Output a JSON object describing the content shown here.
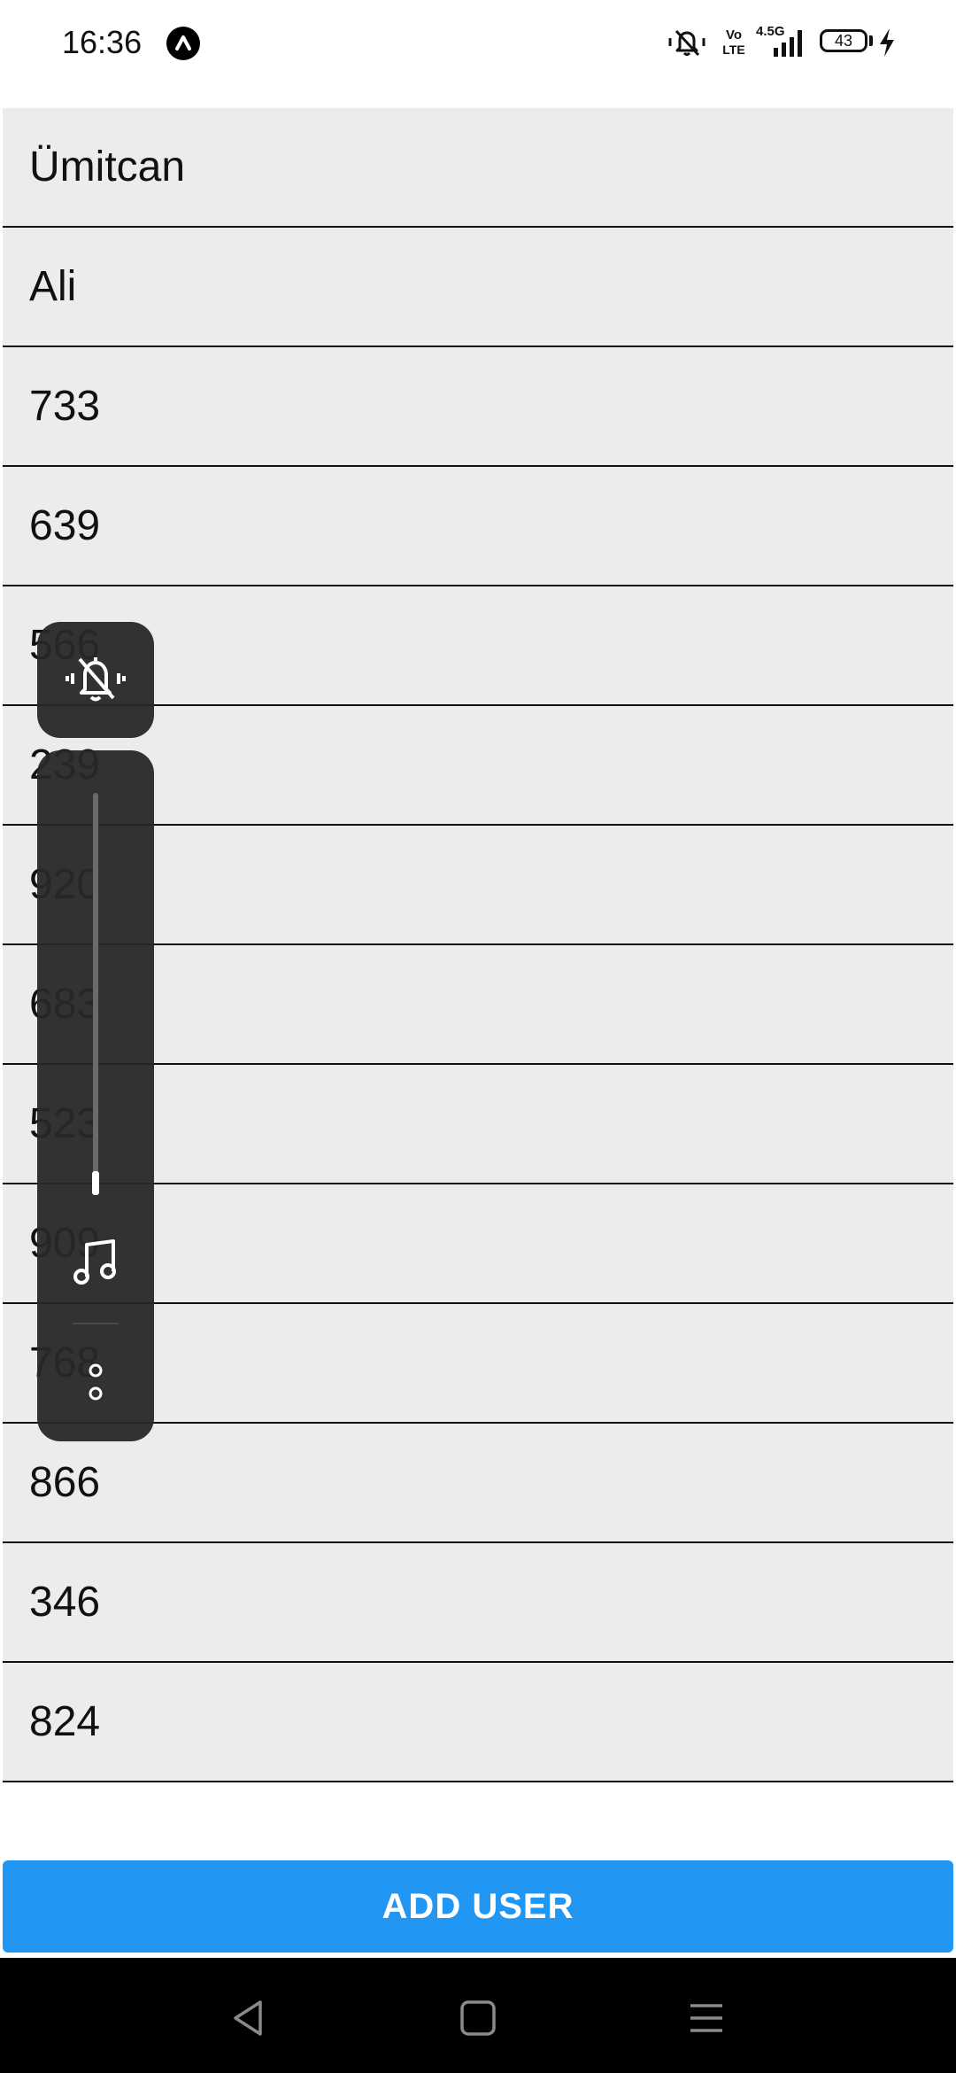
{
  "status_bar": {
    "time": "16:36",
    "network_label": "4.5G",
    "volte_label": "Vo LTE",
    "battery_level": "43",
    "icons": [
      "app-notification-icon",
      "vibrate-mute-icon",
      "volte-icon",
      "signal-icon",
      "battery-icon",
      "charging-icon"
    ]
  },
  "user_list": {
    "items": [
      {
        "label": "Ümitcan"
      },
      {
        "label": "Ali"
      },
      {
        "label": "733"
      },
      {
        "label": "639"
      },
      {
        "label": "566"
      },
      {
        "label": "239"
      },
      {
        "label": "920"
      },
      {
        "label": "683"
      },
      {
        "label": "523"
      },
      {
        "label": "909"
      },
      {
        "label": "768"
      },
      {
        "label": "866"
      },
      {
        "label": "346"
      },
      {
        "label": "824"
      }
    ]
  },
  "add_user_button": {
    "label": "ADD USER",
    "color": "#2196f3"
  },
  "volume_overlay": {
    "mode_icon": "bell-off-vibrate-icon",
    "stream_icon": "music-note-icon",
    "more_icon": "more-options-icon",
    "level_fraction": 0.04
  },
  "navigation_bar": {
    "buttons": [
      "back-icon",
      "home-icon",
      "recents-icon"
    ]
  }
}
